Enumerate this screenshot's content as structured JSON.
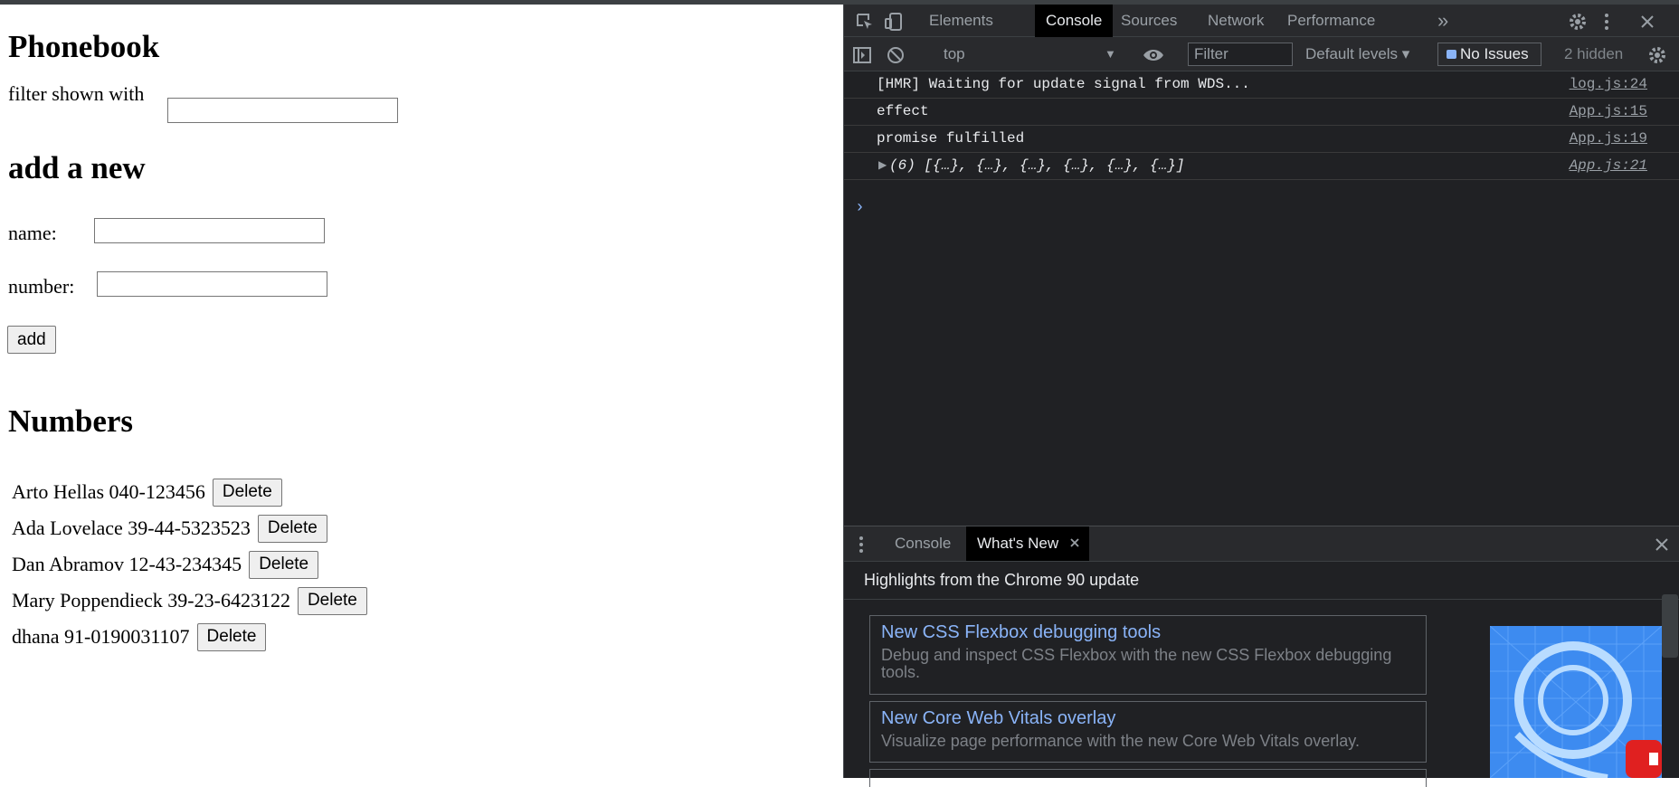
{
  "app": {
    "title": "Phonebook",
    "filter_label": "filter shown with",
    "filter_value": "",
    "add_heading": "add a new",
    "name_label": "name:",
    "name_value": "",
    "number_label": "number:",
    "number_value": "",
    "add_button": "add",
    "numbers_heading": "Numbers",
    "delete_label": "Delete",
    "persons": [
      {
        "entry": "Arto Hellas 040-123456"
      },
      {
        "entry": "Ada Lovelace 39-44-5323523"
      },
      {
        "entry": "Dan Abramov 12-43-234345"
      },
      {
        "entry": "Mary Poppendieck 39-23-6423122"
      },
      {
        "entry": "dhana 91-0190031107"
      }
    ]
  },
  "devtools": {
    "tabs": [
      "Elements",
      "Console",
      "Sources",
      "Network",
      "Performance"
    ],
    "more_tabs": "»",
    "context": "top",
    "filter_placeholder": "Filter",
    "levels": "Default levels ▾",
    "issues": "No Issues",
    "hidden": "2 hidden",
    "console_lines": [
      {
        "text": "[HMR] Waiting for update signal from WDS...",
        "source": "log.js:24"
      },
      {
        "text": "effect",
        "source": "App.js:15"
      },
      {
        "text": "promise fulfilled",
        "source": "App.js:19"
      },
      {
        "text": "(6) [{…}, {…}, {…}, {…}, {…}, {…}]",
        "source": "App.js:21"
      }
    ],
    "prompt_symbol": "›",
    "drawer_tabs": [
      "Console",
      "What's New"
    ],
    "whatsnew_heading": "Highlights from the Chrome 90 update",
    "cards": [
      {
        "title": "New CSS Flexbox debugging tools",
        "desc": "Debug and inspect CSS Flexbox with the new CSS Flexbox debugging tools."
      },
      {
        "title": "New Core Web Vitals overlay",
        "desc": "Visualize page performance with the new Core Web Vitals overlay."
      }
    ],
    "accent_color": "#8ab4f8"
  }
}
